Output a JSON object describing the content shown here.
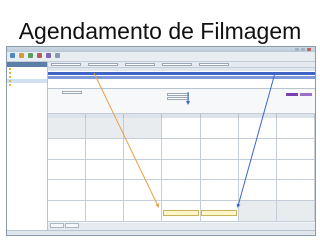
{
  "slide": {
    "title": "Agendamento de Filmagem"
  },
  "colors": {
    "arrow_orange": "#e8a04a",
    "arrow_blue": "#3a66d0",
    "selection": "#3e64c8",
    "highlight_button": "#7a3fb0",
    "appointment": "#fff6c8"
  },
  "window": {
    "title": "",
    "buttons": [
      "minimize-icon",
      "maximize-icon",
      "close-icon"
    ]
  },
  "toolbar": {
    "items": [
      {
        "icon": "home-icon",
        "label": ""
      },
      {
        "icon": "calendar-icon",
        "label": ""
      },
      {
        "icon": "people-icon",
        "label": ""
      },
      {
        "icon": "camera-icon",
        "label": ""
      },
      {
        "icon": "film-icon",
        "label": ""
      },
      {
        "icon": "settings-icon",
        "label": ""
      }
    ]
  },
  "sidebar": {
    "header": "",
    "items": [
      {
        "label": "",
        "selected": false
      },
      {
        "label": "",
        "selected": false
      },
      {
        "label": "",
        "selected": false
      },
      {
        "label": "",
        "selected": true
      },
      {
        "label": "",
        "selected": false
      }
    ]
  },
  "filterbar": {
    "fields": [
      "",
      "",
      "",
      "",
      ""
    ]
  },
  "grid": {
    "columns": [
      "",
      "",
      "",
      "",
      "",
      "",
      ""
    ],
    "rows": [
      {
        "cells": [
          "",
          "",
          "",
          "",
          ""
        ],
        "state": "selected"
      },
      {
        "cells": [
          "",
          "",
          "",
          "",
          ""
        ],
        "state": "selected-light"
      }
    ]
  },
  "detail": {
    "fields": [
      {
        "label": "",
        "value": ""
      },
      {
        "label": "",
        "value": ""
      },
      {
        "label": "",
        "value": ""
      }
    ],
    "buttons": [
      "",
      ""
    ]
  },
  "calendar": {
    "days": [
      "",
      "",
      "",
      "",
      "",
      "",
      ""
    ],
    "appointments": [
      {
        "line1": "",
        "line2": ""
      },
      {
        "line1": "",
        "line2": ""
      }
    ]
  },
  "bottom_tabs": [
    "",
    ""
  ],
  "status": {
    "left": "",
    "right": ""
  }
}
